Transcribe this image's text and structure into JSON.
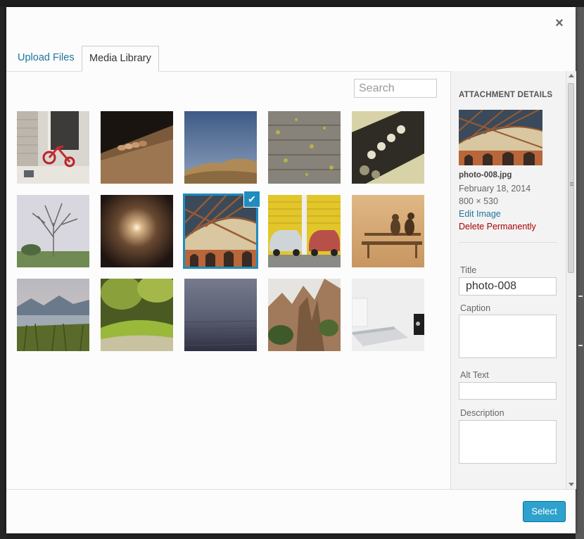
{
  "modal": {
    "close_label": "×"
  },
  "tabs": [
    {
      "label": "Upload Files",
      "active": false
    },
    {
      "label": "Media Library",
      "active": true
    }
  ],
  "search": {
    "placeholder": "Search",
    "value": ""
  },
  "library": {
    "items": [
      {
        "subject": "red tricycle by a door",
        "selected": false
      },
      {
        "subject": "seed pods on wood",
        "selected": false
      },
      {
        "subject": "desert hills under blue sky",
        "selected": false
      },
      {
        "subject": "wooden deck with leaves",
        "selected": false
      },
      {
        "subject": "guitar headstock",
        "selected": false
      },
      {
        "subject": "bare tree in park",
        "selected": false
      },
      {
        "subject": "light at end of tunnel",
        "selected": false
      },
      {
        "subject": "bridge arches from below",
        "selected": true
      },
      {
        "subject": "vintage cars by yellow doors",
        "selected": false
      },
      {
        "subject": "couple on bench at sunset",
        "selected": false
      },
      {
        "subject": "mountain lake with grass",
        "selected": false
      },
      {
        "subject": "mossy forest floor",
        "selected": false
      },
      {
        "subject": "foggy sea",
        "selected": false
      },
      {
        "subject": "rock cliffs and trees",
        "selected": false
      },
      {
        "subject": "laptop on white desk",
        "selected": false
      }
    ],
    "check_icon": "checkmark-icon"
  },
  "details": {
    "heading": "ATTACHMENT DETAILS",
    "filename": "photo-008.jpg",
    "date": "February 18, 2014",
    "dimensions": "800 × 530",
    "edit_label": "Edit Image",
    "delete_label": "Delete Permanently",
    "fields": {
      "title_label": "Title",
      "title_value": "photo-008",
      "caption_label": "Caption",
      "caption_value": "",
      "alt_label": "Alt Text",
      "alt_value": "",
      "description_label": "Description",
      "description_value": ""
    }
  },
  "toolbar": {
    "select_label": "Select"
  },
  "colors": {
    "accent": "#1e8cbe",
    "link": "#21759b",
    "danger": "#aa0000",
    "primary_button": "#2ea2cc"
  }
}
